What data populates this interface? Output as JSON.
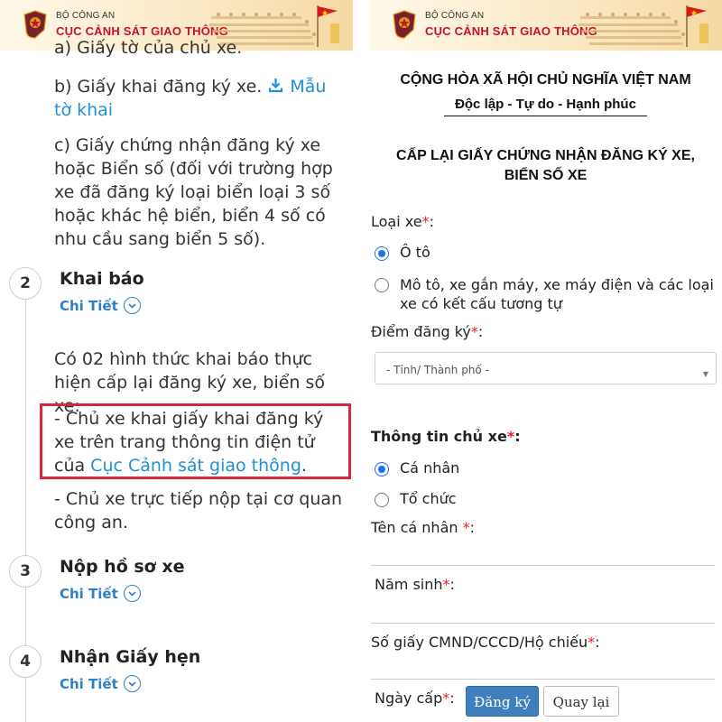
{
  "banner": {
    "org": "BỘ CÔNG AN",
    "dept": "CỤC CẢNH SÁT GIAO THÔNG"
  },
  "left": {
    "item_a": "a) Giấy tờ của chủ xe.",
    "item_b": "b) Giấy khai đăng ký xe.",
    "item_b_link": "Mẫu tờ khai",
    "item_c": "c) Giấy chứng nhận đăng ký xe hoặc Biển số (đối với trường hợp xe đã đăng ký loại biển loại 3 số hoặc khác hệ biển, biển 4 số có nhu cầu sang biển 5 số).",
    "steps": [
      {
        "num": "2",
        "title": "Khai báo",
        "detail": "Chi Tiết"
      },
      {
        "num": "3",
        "title": "Nộp hồ sơ xe",
        "detail": "Chi Tiết"
      },
      {
        "num": "4",
        "title": "Nhận Giấy hẹn",
        "detail": "Chi Tiết"
      }
    ],
    "intro": "Có 02 hình thức khai báo thực hiện cấp lại đăng ký xe, biển số xe:",
    "option1_prefix": "- Chủ xe khai giấy khai đăng ký xe trên trang thông tin điện tử của ",
    "option1_link": "Cục Cảnh sát giao thông",
    "option1_suffix": ".",
    "option2": "- Chủ xe trực tiếp nộp tại cơ quan công an."
  },
  "right": {
    "nation": "CỘNG HÒA XÃ HỘI CHỦ NGHĨA VIỆT NAM",
    "motto": "Độc lập - Tự do - Hạnh phúc",
    "form_title_1": "CẤP LẠI GIẤY CHỨNG NHẬN ĐĂNG KÝ XE,",
    "form_title_2": "BIỂN SỐ XE",
    "vehicle_type_label": "Loại xe",
    "vehicle_options": [
      "Ô tô",
      "Mô tô, xe gắn máy, xe máy điện và các loại xe có kết cấu tương tự"
    ],
    "vehicle_selected": "Ô tô",
    "register_point_label": "Điểm đăng ký",
    "province_placeholder": "- Tỉnh/ Thành phố -",
    "owner_info_label": "Thông tin chủ xe",
    "owner_options": [
      "Cá nhân",
      "Tổ chức"
    ],
    "owner_selected": "Cá nhân",
    "name_label": "Tên cá nhân ",
    "birth_label": "Năm sinh",
    "id_label": "Số giấy CMND/CCCD/Hộ chiếu",
    "issue_date_label": "Ngày cấp",
    "submit_label": "Đăng ký",
    "back_label": "Quay lại",
    "required_mark": "*"
  },
  "colors": {
    "accent_red": "#c8102e",
    "link_blue": "#1f8fd6",
    "primary_button": "#3f7fbd",
    "highlight_box": "#d7263d"
  }
}
